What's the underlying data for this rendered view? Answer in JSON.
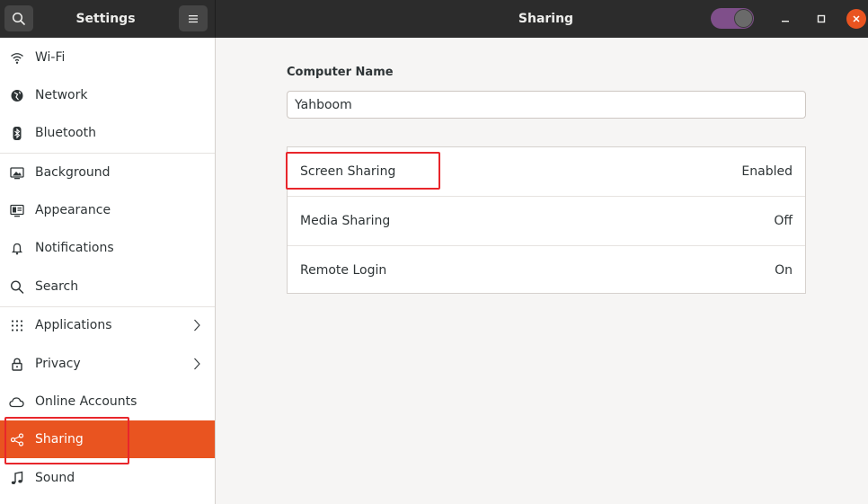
{
  "sidebar_title": "Settings",
  "panel_title": "Sharing",
  "sidebar": {
    "items": [
      {
        "label": "Wi-Fi",
        "icon": "wifi-icon"
      },
      {
        "label": "Network",
        "icon": "network-icon"
      },
      {
        "label": "Bluetooth",
        "icon": "bluetooth-icon"
      },
      {
        "label": "Background",
        "icon": "background-icon"
      },
      {
        "label": "Appearance",
        "icon": "appearance-icon"
      },
      {
        "label": "Notifications",
        "icon": "bell-icon"
      },
      {
        "label": "Search",
        "icon": "search-icon"
      },
      {
        "label": "Applications",
        "icon": "apps-grid-icon",
        "has_submenu": true
      },
      {
        "label": "Privacy",
        "icon": "lock-icon",
        "has_submenu": true
      },
      {
        "label": "Online Accounts",
        "icon": "cloud-icon"
      },
      {
        "label": "Sharing",
        "icon": "share-icon",
        "active": true
      },
      {
        "label": "Sound",
        "icon": "music-note-icon"
      }
    ]
  },
  "sharing": {
    "computer_name_label": "Computer Name",
    "computer_name_value": "Yahboom",
    "rows": [
      {
        "label": "Screen Sharing",
        "value": "Enabled"
      },
      {
        "label": "Media Sharing",
        "value": "Off"
      },
      {
        "label": "Remote Login",
        "value": "On"
      }
    ]
  },
  "sharing_toggle": {
    "state": "on"
  },
  "colors": {
    "accent": "#e95420",
    "header": "#2c2c2c",
    "toggle_on": "#7f4f8a",
    "highlight": "#e8262b"
  }
}
